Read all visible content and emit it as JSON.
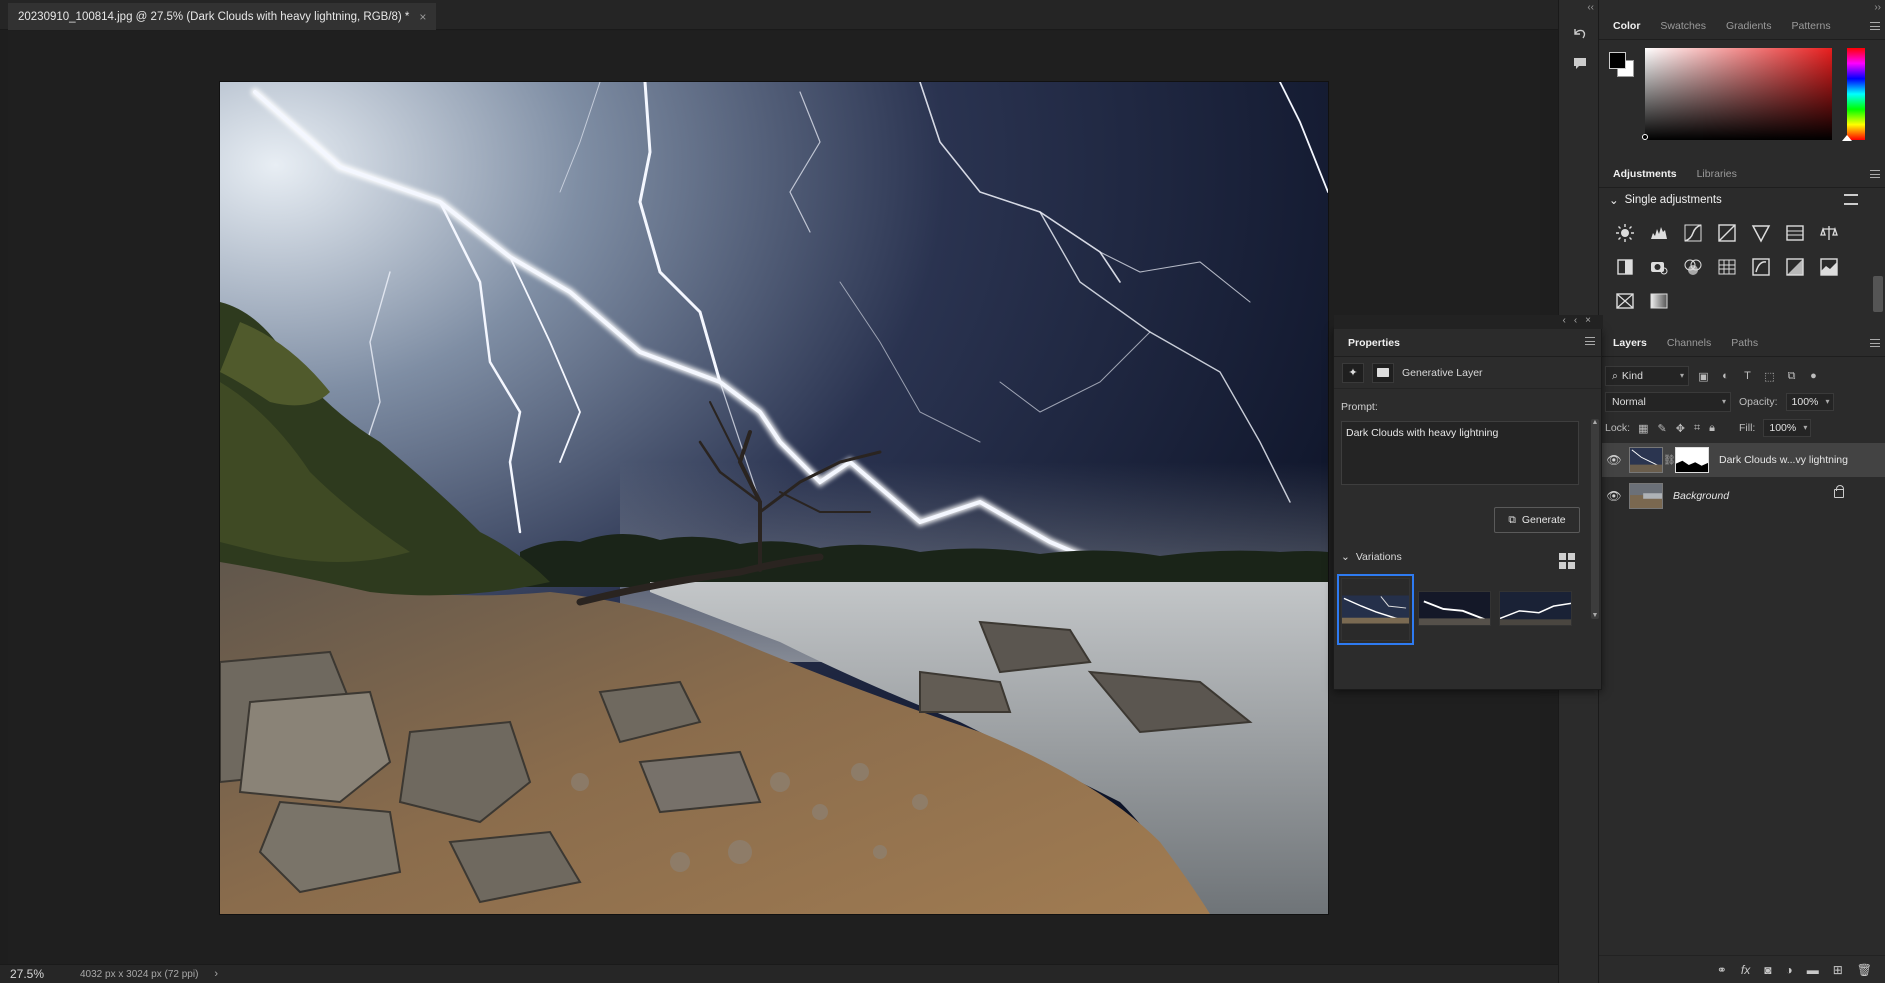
{
  "document": {
    "tab_title": "20230910_100814.jpg @ 27.5% (Dark Clouds with heavy lightning, RGB/8) *",
    "close_glyph": "×"
  },
  "status": {
    "zoom": "27.5%",
    "doc_info": "4032 px x 3024 px (72 ppi)",
    "chevron": "›"
  },
  "color_panel": {
    "tabs": [
      "Color",
      "Swatches",
      "Gradients",
      "Patterns"
    ],
    "foreground": "#000000",
    "background": "#ffffff"
  },
  "adjustments": {
    "tabs": [
      "Adjustments",
      "Libraries"
    ],
    "section_title": "Single adjustments",
    "icons": [
      "brightness-contrast-icon",
      "levels-icon",
      "curves-icon",
      "exposure-icon",
      "vibrance-icon",
      "hue-saturation-icon",
      "color-balance-icon",
      "black-white-icon",
      "photo-filter-icon",
      "channel-mixer-icon",
      "color-lookup-icon",
      "invert-icon",
      "posterize-icon",
      "threshold-icon",
      "selective-color-icon",
      "gradient-map-icon"
    ]
  },
  "properties": {
    "tab": "Properties",
    "layer_type": "Generative Layer",
    "prompt_label": "Prompt:",
    "prompt_text": "Dark Clouds with heavy lightning",
    "generate_label": "Generate",
    "variations_label": "Variations"
  },
  "layers_panel": {
    "tabs": [
      "Layers",
      "Channels",
      "Paths"
    ],
    "filter_kind": "Kind",
    "blend_mode": "Normal",
    "opacity_label": "Opacity:",
    "opacity": "100%",
    "lock_label": "Lock:",
    "fill_label": "Fill:",
    "fill": "100%",
    "layers": [
      {
        "name": "Dark Clouds w...vy lightning",
        "visible": true,
        "selected": true
      },
      {
        "name": "Background",
        "visible": true,
        "locked": true
      }
    ]
  },
  "accent_color": "#2e7bf2"
}
